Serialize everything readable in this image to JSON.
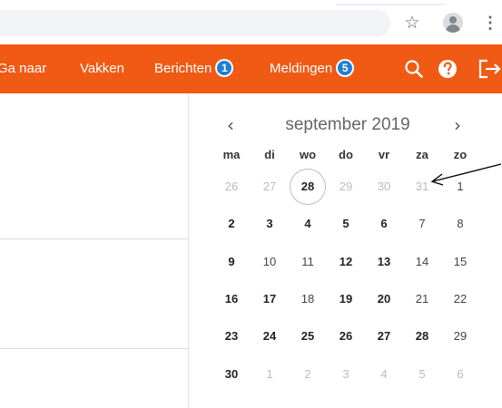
{
  "browser": {
    "icons": [
      "star-icon",
      "profile-icon",
      "menu-dots-icon"
    ],
    "kebab": "⋮",
    "star": "☆"
  },
  "navbar": {
    "color": "#f05a14",
    "items": [
      "Ga naar",
      "Vakken",
      "Berichten",
      "Meldingen"
    ],
    "berichten_count": "1",
    "meldingen_count": "5",
    "badge_color": "#1f7fd4",
    "icons": [
      "search-icon",
      "help-icon",
      "logout-icon"
    ]
  },
  "calendar": {
    "title": "september 2019",
    "prev": "‹",
    "next": "›",
    "weekdays": [
      "ma",
      "di",
      "wo",
      "do",
      "vr",
      "za",
      "zo"
    ],
    "weeks": [
      [
        "26",
        "27",
        "28",
        "29",
        "30",
        "31",
        "1"
      ],
      [
        "2",
        "3",
        "4",
        "5",
        "6",
        "7",
        "8"
      ],
      [
        "9",
        "10",
        "11",
        "12",
        "13",
        "14",
        "15"
      ],
      [
        "16",
        "17",
        "18",
        "19",
        "20",
        "21",
        "22"
      ],
      [
        "23",
        "24",
        "25",
        "26",
        "27",
        "28",
        "29"
      ],
      [
        "30",
        "1",
        "2",
        "3",
        "4",
        "5",
        "6"
      ]
    ],
    "today": "28",
    "annotation": "arrow-pointing-to-31"
  }
}
